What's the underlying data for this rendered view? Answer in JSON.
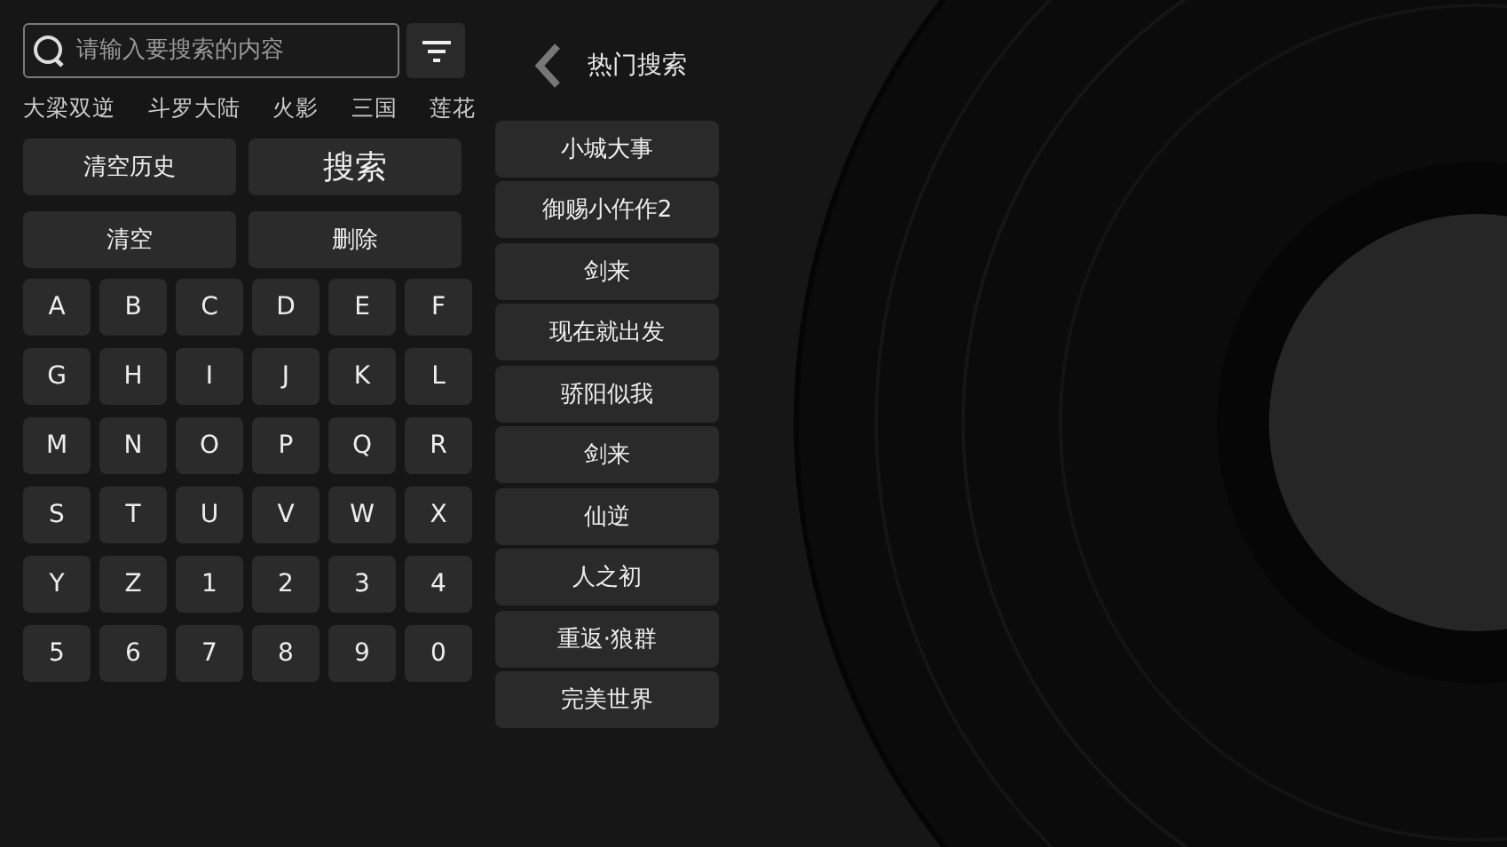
{
  "search": {
    "placeholder": "请输入要搜索的内容"
  },
  "history": [
    "大梁双逆",
    "斗罗大陆",
    "火影",
    "三国",
    "莲花"
  ],
  "actions": [
    {
      "label": "清空历史",
      "kind": "normal"
    },
    {
      "label": "搜索",
      "kind": "primary"
    },
    {
      "label": "清空",
      "kind": "normal"
    },
    {
      "label": "删除",
      "kind": "normal"
    }
  ],
  "keys": [
    "A",
    "B",
    "C",
    "D",
    "E",
    "F",
    "G",
    "H",
    "I",
    "J",
    "K",
    "L",
    "M",
    "N",
    "O",
    "P",
    "Q",
    "R",
    "S",
    "T",
    "U",
    "V",
    "W",
    "X",
    "Y",
    "Z",
    "1",
    "2",
    "3",
    "4",
    "5",
    "6",
    "7",
    "8",
    "9",
    "0"
  ],
  "hot": {
    "title": "热门搜索",
    "items": [
      "小城大事",
      "御赐小仵作2",
      "剑来",
      "现在就出发",
      "骄阳似我",
      "剑来",
      "仙逆",
      "人之初",
      "重返·狼群",
      "完美世界"
    ]
  }
}
